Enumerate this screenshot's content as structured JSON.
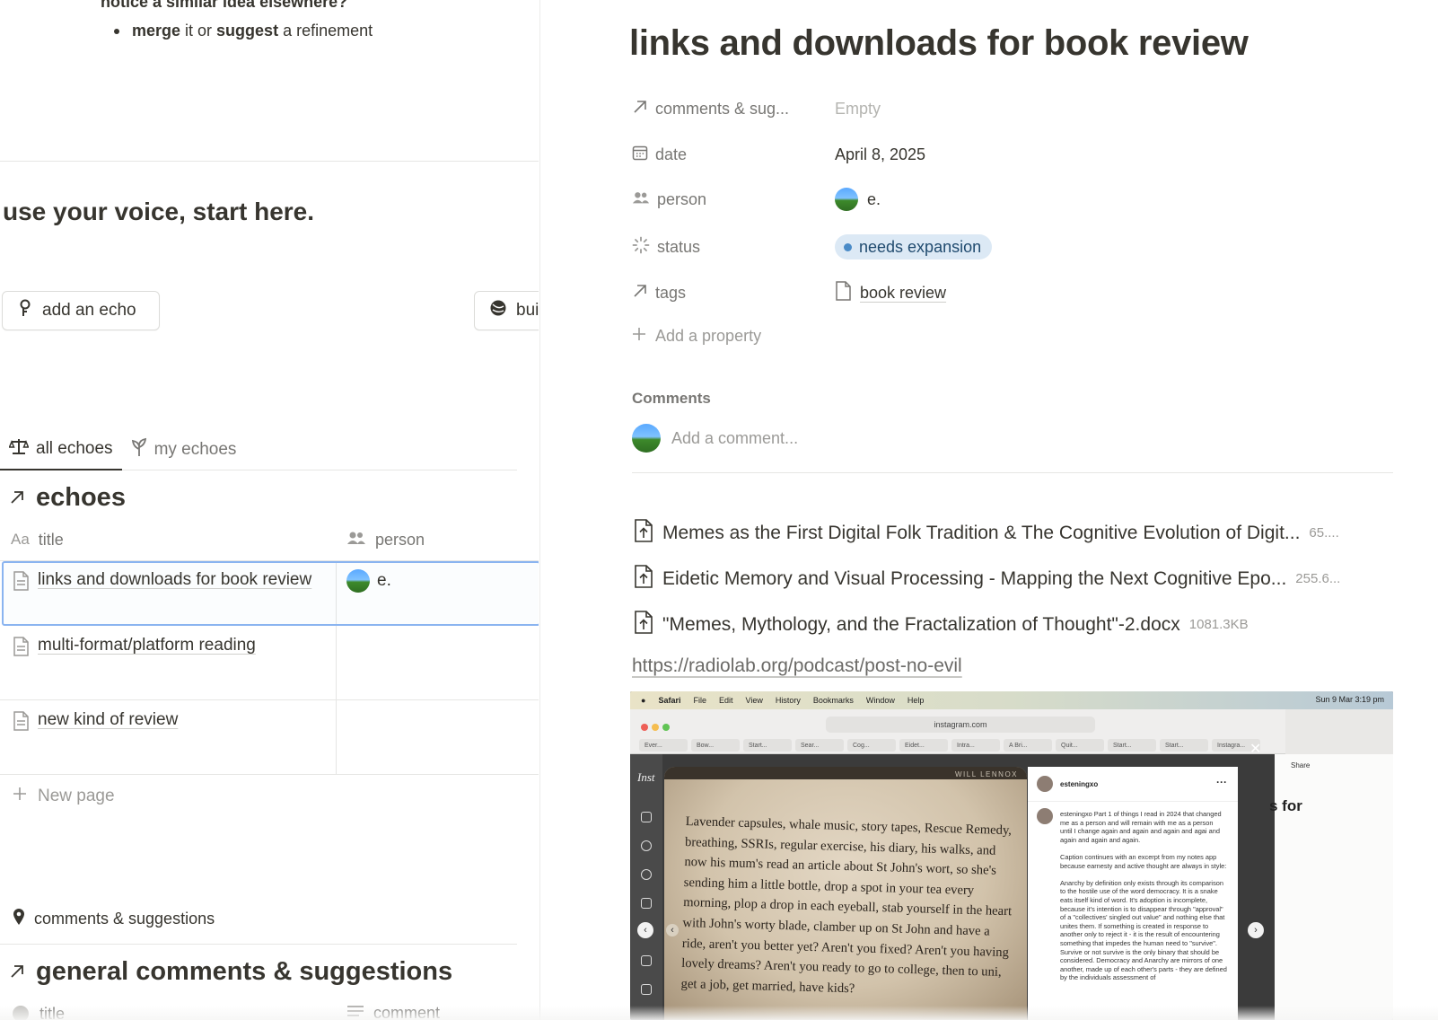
{
  "left": {
    "cut_line": "notice a similar idea elsewhere?",
    "bullet": {
      "bold1": "merge",
      "mid": " it or ",
      "bold2": "suggest",
      "tail": " a refinement"
    },
    "voice_heading": "use your voice, start here.",
    "buttons": {
      "add_echo": "add an echo",
      "build": "bui"
    },
    "tabs": [
      {
        "label": "all echoes",
        "active": true
      },
      {
        "label": "my echoes",
        "active": false
      }
    ],
    "database_title": "echoes",
    "columns": {
      "title": "title",
      "title_prefix": "Aa",
      "person": "person"
    },
    "rows": [
      {
        "title": "links and downloads for book review",
        "person": "e."
      },
      {
        "title": "multi-format/platform reading",
        "person": ""
      },
      {
        "title": "new kind of review",
        "person": ""
      }
    ],
    "new_page": "New page",
    "comments_tab": "comments & suggestions",
    "general_title": "general comments & suggestions",
    "general_columns": {
      "title": "title",
      "comment": "comment"
    }
  },
  "page": {
    "title": "links and downloads for book review",
    "properties": [
      {
        "name": "comments & sug...",
        "icon": "arrow-up-right-icon",
        "value": "Empty",
        "empty": true
      },
      {
        "name": "date",
        "icon": "calendar-icon",
        "value": "April 8, 2025"
      },
      {
        "name": "person",
        "icon": "people-icon",
        "value": "e."
      },
      {
        "name": "status",
        "icon": "status-icon",
        "value": "needs expansion"
      },
      {
        "name": "tags",
        "icon": "arrow-up-right-icon",
        "value": "book review"
      }
    ],
    "add_property": "Add a property",
    "comments_label": "Comments",
    "comment_placeholder": "Add a comment...",
    "files": [
      {
        "name": "Memes as the First Digital Folk Tradition & The Cognitive Evolution of Digit...",
        "size": "65...."
      },
      {
        "name": "Eidetic Memory and Visual Processing - Mapping the Next Cognitive Epo...",
        "size": "255.6..."
      },
      {
        "name": "\"Memes, Mythology, and the Fractalization of Thought\"-2.docx",
        "size": "1081.3KB"
      }
    ],
    "link": "https://radiolab.org/podcast/post-no-evil"
  },
  "screenshot": {
    "menubar": [
      "Safari",
      "File",
      "Edit",
      "View",
      "History",
      "Bookmarks",
      "Window",
      "Help"
    ],
    "clock": "Sun 9 Mar  3:19 pm",
    "url": "instagram.com",
    "tabs": [
      "Ever...",
      "Bow...",
      "Start...",
      "Sear...",
      "Cog...",
      "Eidet...",
      "Intra...",
      "A Bri...",
      "Quit...",
      "Start...",
      "Start...",
      "Instagra..."
    ],
    "ig_logo": "Inst",
    "ig_right_text": "s for",
    "share": "Share",
    "book_text": "Lavender capsules, whale music, story tapes, Rescue Remedy, breathing, SSRIs, regular exercise, his diary, his walks, and now his mum's read an article about St John's wort, so she's sending him a little bottle, drop a spot in your tea every morning, plop a drop in each eyeball, stab yourself in the heart with John's worty blade, clamber up on St John and have a ride, aren't you better yet? Aren't you fixed? Aren't you having lovely dreams? Aren't you ready to go to college, then to uni, get a job, get married, have kids?",
    "book_header": "WILL LENNOX",
    "post_user": "esteningxo",
    "post_text": "esteningxo Part 1 of things I read in 2024 that changed me as a person and will remain with me as a person until I change again and again and again and agai and again and again and again.\n\nCaption continues with an excerpt from my notes app because earnesty and active thought are always in style:\n\nAnarchy by definition only exists through its comparison to the hostile use of the word democracy. It is a snake eats itself kind of word. It's adoption is incomplete, because it's intention is to disappear through \"approval\" of a \"collectives' singled out value\" and nothing else that unites them. If something is created in response to another only to reject it - it is the result of encountering something that impedes the human need to \"survive\". Survive or not survive is the only binary that should be considered. Democracy and Anarchy are mirrors of one another, made up of each other's parts - they are defined by the individuals assessment of"
  },
  "colors": {
    "accent_blue": "#2383e2",
    "status_bg": "#dce9f5",
    "status_dot": "#4a8bc7",
    "text": "#37352f",
    "muted": "#787774"
  }
}
